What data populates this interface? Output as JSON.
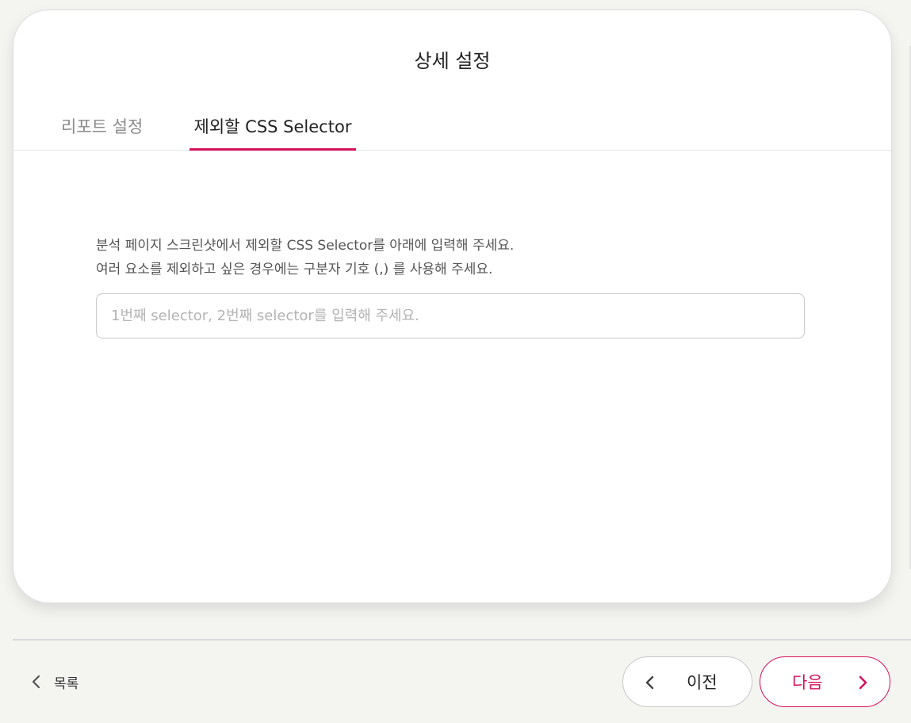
{
  "dialog": {
    "title": "상세 설정",
    "tabs": [
      {
        "label": "리포트 설정",
        "active": false
      },
      {
        "label": "제외할 CSS Selector",
        "active": true
      }
    ],
    "description": [
      "분석 페이지 스크린샷에서 제외할 CSS Selector를 아래에 입력해 주세요.",
      "여러 요소를 제외하고 싶은 경우에는 구분자 기호 (,) 를 사용해 주세요."
    ],
    "selector_input": {
      "value": "",
      "placeholder": "1번째 selector, 2번째 selector를 입력해 주세요."
    }
  },
  "footer": {
    "list_label": "목록",
    "prev_label": "이전",
    "next_label": "다음"
  },
  "colors": {
    "accent": "#d6135d",
    "background": "#f4f4f1"
  },
  "icons": {
    "list": "chevron-left-icon",
    "prev": "chevron-left-icon",
    "next": "chevron-right-icon"
  }
}
